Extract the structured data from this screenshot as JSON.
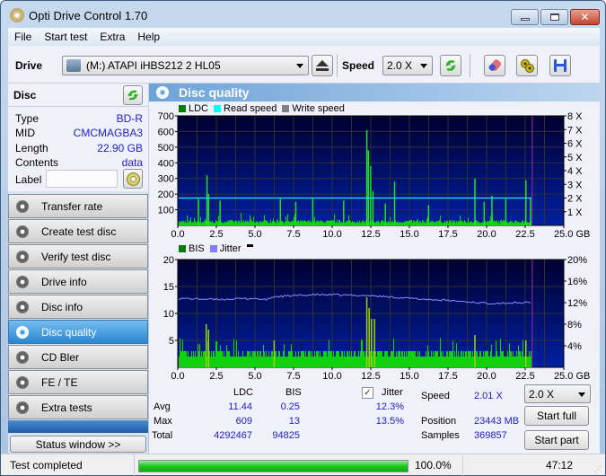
{
  "window": {
    "title": "Opti Drive Control 1.70"
  },
  "menu": [
    "File",
    "Start test",
    "Extra",
    "Help"
  ],
  "toolbar": {
    "drive_label": "Drive",
    "drive_value": "(M:)   ATAPI iHBS212   2 HL05",
    "speed_label": "Speed",
    "speed_value": "2.0 X"
  },
  "disc": {
    "header": "Disc",
    "rows": [
      {
        "label": "Type",
        "value": "BD-R"
      },
      {
        "label": "MID",
        "value": "CMCMAGBA3"
      },
      {
        "label": "Length",
        "value": "22.90 GB"
      },
      {
        "label": "Contents",
        "value": "data"
      }
    ],
    "label_field": "Label",
    "label_value": ""
  },
  "nav": [
    {
      "label": "Transfer rate",
      "active": false
    },
    {
      "label": "Create test disc",
      "active": false
    },
    {
      "label": "Verify test disc",
      "active": false
    },
    {
      "label": "Drive info",
      "active": false
    },
    {
      "label": "Disc info",
      "active": false
    },
    {
      "label": "Disc quality",
      "active": true
    },
    {
      "label": "CD Bler",
      "active": false
    },
    {
      "label": "FE / TE",
      "active": false
    },
    {
      "label": "Extra tests",
      "active": false
    }
  ],
  "status_window_btn": "Status window >>",
  "panel": {
    "title": "Disc quality"
  },
  "chart_data": [
    {
      "type": "bar",
      "title": "LDC",
      "legend": [
        {
          "name": "LDC",
          "color": "#008000"
        },
        {
          "name": "Read speed",
          "color": "#00ffff"
        },
        {
          "name": "Write speed",
          "color": "#808080"
        }
      ],
      "xlabel": "GB",
      "xlim": [
        0,
        25
      ],
      "x_ticks": [
        "0.0",
        "2.5",
        "5.0",
        "7.5",
        "10.0",
        "12.5",
        "15.0",
        "17.5",
        "20.0",
        "22.5",
        "25.0 GB"
      ],
      "ylim": [
        0,
        700
      ],
      "y_ticks": [
        "100",
        "200",
        "300",
        "400",
        "500",
        "600",
        "700"
      ],
      "y2lim": [
        0,
        8
      ],
      "y2_ticks": [
        "1 X",
        "2 X",
        "3 X",
        "4 X",
        "5 X",
        "6 X",
        "7 X",
        "8 X"
      ],
      "data_end_gb": 22.9,
      "read_speed_x": 2.0,
      "baseline_ldc": 15,
      "peaks": [
        {
          "x": 1.3,
          "y": 170
        },
        {
          "x": 1.85,
          "y": 320
        },
        {
          "x": 1.95,
          "y": 200
        },
        {
          "x": 2.7,
          "y": 160
        },
        {
          "x": 6.6,
          "y": 170
        },
        {
          "x": 7.6,
          "y": 150
        },
        {
          "x": 8.7,
          "y": 170
        },
        {
          "x": 10.7,
          "y": 160
        },
        {
          "x": 12.2,
          "y": 609
        },
        {
          "x": 12.3,
          "y": 480
        },
        {
          "x": 12.45,
          "y": 380
        },
        {
          "x": 12.6,
          "y": 220
        },
        {
          "x": 13.4,
          "y": 140
        },
        {
          "x": 14.0,
          "y": 280
        },
        {
          "x": 16.2,
          "y": 130
        },
        {
          "x": 19.2,
          "y": 300
        },
        {
          "x": 19.8,
          "y": 150
        },
        {
          "x": 20.3,
          "y": 190
        },
        {
          "x": 21.2,
          "y": 170
        },
        {
          "x": 22.5,
          "y": 290
        },
        {
          "x": 22.8,
          "y": 180
        }
      ]
    },
    {
      "type": "bar",
      "title": "BIS / Jitter",
      "legend": [
        {
          "name": "BIS",
          "color": "#008000"
        },
        {
          "name": "Jitter",
          "color": "#8080ff"
        }
      ],
      "xlabel": "GB",
      "xlim": [
        0,
        25
      ],
      "x_ticks": [
        "0.0",
        "2.5",
        "5.0",
        "7.5",
        "10.0",
        "12.5",
        "15.0",
        "17.5",
        "20.0",
        "22.5",
        "25.0 GB"
      ],
      "ylim": [
        0,
        20
      ],
      "y_ticks": [
        "5",
        "10",
        "15",
        "20"
      ],
      "y2lim": [
        0,
        20
      ],
      "y2_ticks": [
        "4%",
        "8%",
        "12%",
        "16%",
        "20%"
      ],
      "data_end_gb": 22.9,
      "jitter_percent": [
        {
          "x": 0,
          "y": 12.8
        },
        {
          "x": 2.5,
          "y": 12.6
        },
        {
          "x": 5.0,
          "y": 12.8
        },
        {
          "x": 5.7,
          "y": 12.5
        },
        {
          "x": 6.2,
          "y": 13.1
        },
        {
          "x": 9.0,
          "y": 13.5
        },
        {
          "x": 12.5,
          "y": 13.3
        },
        {
          "x": 15.0,
          "y": 12.8
        },
        {
          "x": 17.5,
          "y": 12.4
        },
        {
          "x": 20.0,
          "y": 11.9
        },
        {
          "x": 22.8,
          "y": 12.0
        }
      ],
      "bis_peaks": [
        {
          "x": 1.8,
          "y": 8
        },
        {
          "x": 1.95,
          "y": 7
        },
        {
          "x": 6.2,
          "y": 5
        },
        {
          "x": 12.2,
          "y": 13
        },
        {
          "x": 12.35,
          "y": 11
        },
        {
          "x": 12.5,
          "y": 9
        },
        {
          "x": 12.7,
          "y": 9
        },
        {
          "x": 19.2,
          "y": 6
        },
        {
          "x": 22.5,
          "y": 5
        }
      ]
    }
  ],
  "stats": {
    "columns": [
      "LDC",
      "BIS"
    ],
    "rows": [
      {
        "label": "Avg",
        "ldc": "11.44",
        "bis": "0.25",
        "jitter": "12.3%"
      },
      {
        "label": "Max",
        "ldc": "609",
        "bis": "13",
        "jitter": "13.5%"
      },
      {
        "label": "Total",
        "ldc": "4292467",
        "bis": "94825",
        "jitter": ""
      }
    ],
    "jitter_label": "Jitter",
    "jitter_checked": true,
    "speed_label": "Speed",
    "speed_value": "2.01 X",
    "position_label": "Position",
    "position_value": "23443 MB",
    "samples_label": "Samples",
    "samples_value": "369857",
    "speed_select": "2.0 X",
    "start_full": "Start full",
    "start_part": "Start part"
  },
  "status": {
    "text": "Test completed",
    "progress_percent": 100.0,
    "progress_label": "100.0%",
    "time": "47:12"
  }
}
